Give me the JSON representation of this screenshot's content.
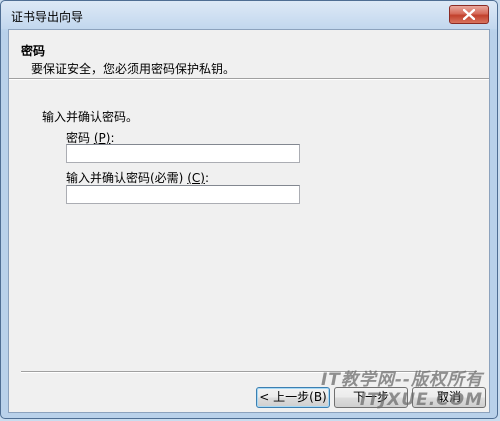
{
  "window": {
    "title": "证书导出向导"
  },
  "header": {
    "title": "密码",
    "description": "要保证安全，您必须用密码保护私钥。"
  },
  "form": {
    "instruction": "输入并确认密码。",
    "password_label_text": "密码 ",
    "password_label_mnemonic": "(P)",
    "password_label_suffix": ":",
    "password_value": "",
    "confirm_label_text": "输入并确认密码(必需) ",
    "confirm_label_mnemonic": "(C)",
    "confirm_label_suffix": ":",
    "confirm_value": ""
  },
  "buttons": {
    "back": "< 上一步(B)",
    "next": "下一步",
    "cancel": "取消"
  },
  "watermark": {
    "line1": "IT教学网--版权所有",
    "line2": "ITJXUE.COM"
  },
  "icons": {
    "close": "close-icon"
  },
  "colors": {
    "close_button": "#c2412d",
    "title_bar": "#c2d7ee"
  }
}
